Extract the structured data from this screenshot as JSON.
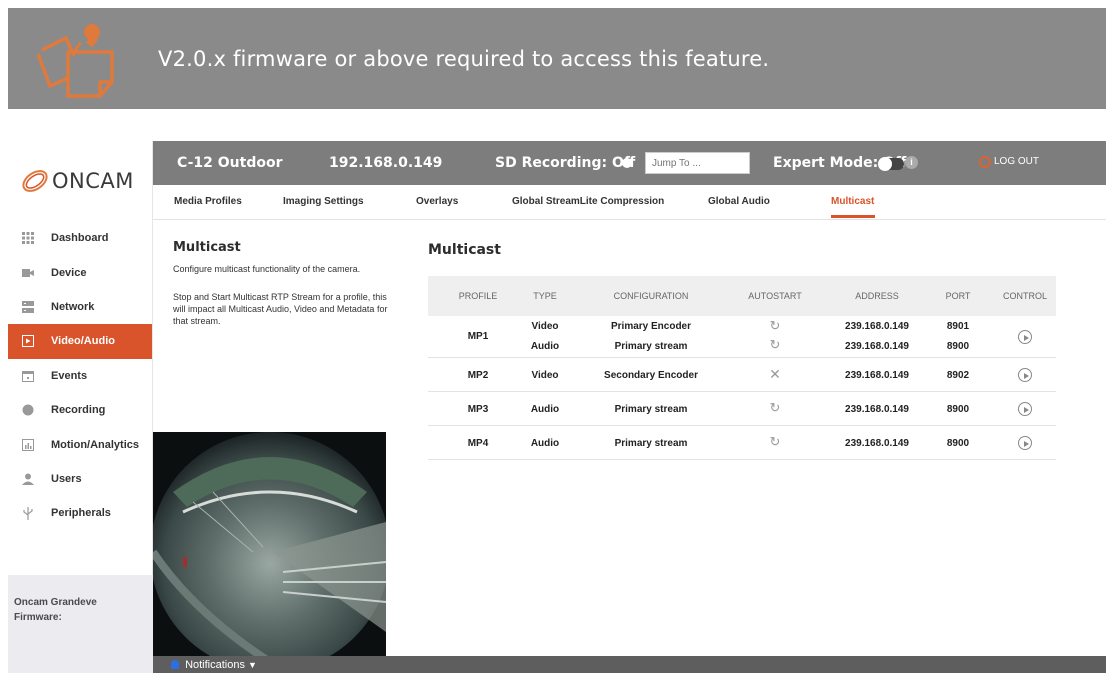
{
  "banner": {
    "message": "V2.0.x firmware or above required to access this feature."
  },
  "brand": {
    "logo_text": "ONCAM",
    "accent": "#d9542b"
  },
  "sidebar": {
    "items": [
      {
        "label": "Dashboard",
        "icon": "grid-icon"
      },
      {
        "label": "Device",
        "icon": "camera-icon"
      },
      {
        "label": "Network",
        "icon": "network-icon"
      },
      {
        "label": "Video/Audio",
        "icon": "video-icon",
        "active": true
      },
      {
        "label": "Events",
        "icon": "calendar-icon"
      },
      {
        "label": "Recording",
        "icon": "record-icon"
      },
      {
        "label": "Motion/Analytics",
        "icon": "chart-icon"
      },
      {
        "label": "Users",
        "icon": "user-icon"
      },
      {
        "label": "Peripherals",
        "icon": "usb-icon"
      }
    ],
    "footer_product": "Oncam Grandeve",
    "footer_firmware": "Firmware:"
  },
  "topbar": {
    "camera_name": "C-12 Outdoor",
    "ip": "192.168.0.149",
    "sd_recording": "SD Recording: Off",
    "jump_placeholder": "Jump To ...",
    "expert_mode": "Expert Mode: Off",
    "logout": "LOG OUT"
  },
  "tabs": [
    "Media Profiles",
    "Imaging Settings",
    "Overlays",
    "Global StreamLite Compression",
    "Global Audio",
    "Multicast"
  ],
  "active_tab": "Multicast",
  "info": {
    "title": "Multicast",
    "line1": "Configure multicast functionality of the camera.",
    "line2": "Stop and Start Multicast RTP Stream for a profile, this will impact all Multicast Audio, Video and Metadata for that stream."
  },
  "multicast": {
    "title": "Multicast",
    "columns": [
      "PROFILE",
      "TYPE",
      "CONFIGURATION",
      "AUTOSTART",
      "ADDRESS",
      "PORT",
      "CONTROL"
    ],
    "rows": [
      {
        "profile": "MP1",
        "streams": [
          {
            "type": "Video",
            "configuration": "Primary Encoder",
            "autostart": "sync-icon",
            "address": "239.168.0.149",
            "port": "8901"
          },
          {
            "type": "Audio",
            "configuration": "Primary stream",
            "autostart": "sync-icon",
            "address": "239.168.0.149",
            "port": "8900"
          }
        ]
      },
      {
        "profile": "MP2",
        "streams": [
          {
            "type": "Video",
            "configuration": "Secondary Encoder",
            "autostart": "x-icon",
            "address": "239.168.0.149",
            "port": "8902"
          }
        ]
      },
      {
        "profile": "MP3",
        "streams": [
          {
            "type": "Audio",
            "configuration": "Primary stream",
            "autostart": "sync-icon",
            "address": "239.168.0.149",
            "port": "8900"
          }
        ]
      },
      {
        "profile": "MP4",
        "streams": [
          {
            "type": "Audio",
            "configuration": "Primary stream",
            "autostart": "sync-icon",
            "address": "239.168.0.149",
            "port": "8900"
          }
        ]
      }
    ]
  },
  "notifications": {
    "label": "Notifications"
  }
}
